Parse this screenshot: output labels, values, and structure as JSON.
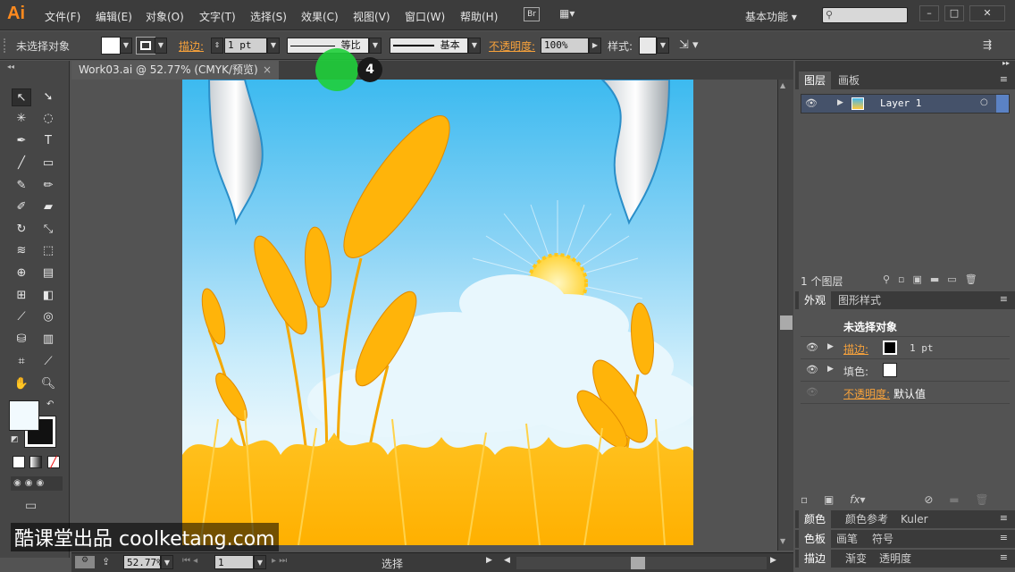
{
  "app": {
    "logo": "Ai"
  },
  "menu": [
    "文件(F)",
    "编辑(E)",
    "对象(O)",
    "文字(T)",
    "选择(S)",
    "效果(C)",
    "视图(V)",
    "窗口(W)",
    "帮助(H)"
  ],
  "bridge_label": "Br",
  "workspace": "基本功能",
  "control": {
    "selection": "未选择对象",
    "stroke_label": "描边:",
    "stroke_weight": "1 pt",
    "profile_label": "等比",
    "brush_label": "基本",
    "opacity_label": "不透明度:",
    "opacity_value": "100%",
    "style_label": "样式:"
  },
  "document": {
    "tab_title": "Work03.ai @ 52.77% (CMYK/预览)",
    "close": "×"
  },
  "status": {
    "zoom": "52.77%",
    "page": "1",
    "tool": "选择"
  },
  "layers_panel": {
    "tabs": [
      "图层",
      "画板"
    ],
    "layer_name": "Layer 1",
    "count": "1 个图层"
  },
  "appearance_panel": {
    "tabs": [
      "外观",
      "图形样式"
    ],
    "title": "未选择对象",
    "stroke_label": "描边:",
    "stroke_value": "1 pt",
    "fill_label": "填色:",
    "opacity_label": "不透明度:",
    "opacity_value": "默认值"
  },
  "collapsed_panels": [
    [
      "颜色",
      "颜色参考",
      "Kuler"
    ],
    [
      "色板",
      "画笔",
      "符号"
    ],
    [
      "描边",
      "渐变",
      "透明度"
    ]
  ],
  "overlay": {
    "step": "4",
    "watermark": "酷课堂出品 coolketang.com"
  },
  "colors": {
    "accent_orange": "#f7a23b",
    "cursor_green": "#1fcf3a"
  }
}
